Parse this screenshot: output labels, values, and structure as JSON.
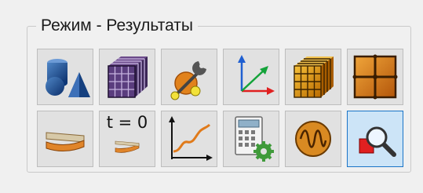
{
  "group": {
    "title": "Режим - Результаты"
  },
  "tools": [
    {
      "id": "geometry",
      "icon": "geometry-shapes-icon",
      "selected": false
    },
    {
      "id": "mesh",
      "icon": "mesh-cube-icon",
      "selected": false
    },
    {
      "id": "physics",
      "icon": "physics-settings-icon",
      "selected": false
    },
    {
      "id": "coordinate-system",
      "icon": "coordinate-axes-icon",
      "selected": false
    },
    {
      "id": "element-mesh",
      "icon": "element-cube-icon",
      "selected": false
    },
    {
      "id": "grid",
      "icon": "grid-plate-icon",
      "selected": false
    },
    {
      "id": "deformation",
      "icon": "deformed-beam-icon",
      "selected": false
    },
    {
      "id": "initial-state",
      "icon": "time-zero-icon",
      "label": "t = 0",
      "selected": false
    },
    {
      "id": "plot",
      "icon": "xy-plot-icon",
      "selected": false
    },
    {
      "id": "calculator",
      "icon": "calculator-gear-icon",
      "selected": false
    },
    {
      "id": "oscillation",
      "icon": "oscillation-icon",
      "selected": false
    },
    {
      "id": "inspect",
      "icon": "magnifier-inspect-icon",
      "selected": true
    }
  ],
  "colors": {
    "selected_bg": "#cce4f7",
    "selected_border": "#1a74c7",
    "button_bg": "#e1e1e1"
  }
}
